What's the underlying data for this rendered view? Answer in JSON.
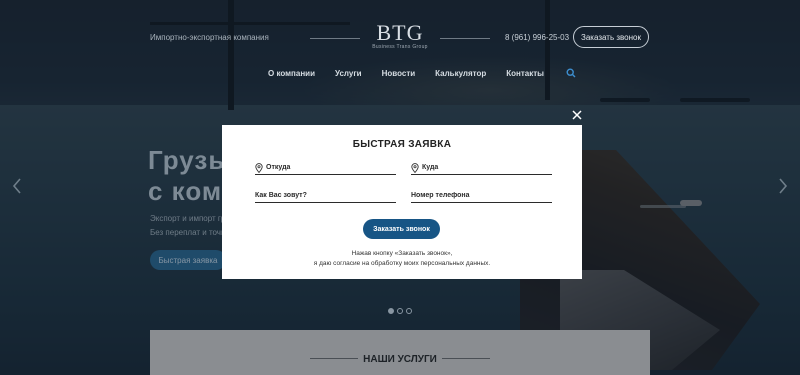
{
  "header": {
    "tagline": "Импортно-экспортная компания",
    "logo_text": "BTG",
    "logo_subtitle": "Business Trans Group",
    "phone": "8 (961) 996-25-03",
    "call_button": "Заказать звонок"
  },
  "nav": {
    "items": [
      {
        "label": "О компании"
      },
      {
        "label": "Услуги"
      },
      {
        "label": "Новости"
      },
      {
        "label": "Калькулятор"
      },
      {
        "label": "Контакты"
      }
    ],
    "search_icon": "search-icon"
  },
  "hero": {
    "title_line1": "Грузы",
    "title_line2": "с ком",
    "text_line1": "Экспорт и импорт гру",
    "text_line2": "Без переплат и точно",
    "button": "Быстрая заявка"
  },
  "slider": {
    "prev_icon": "chevron-left-icon",
    "next_icon": "chevron-right-icon",
    "active_slide": 1,
    "slide_count": 3
  },
  "services": {
    "title": "НАШИ УСЛУГИ"
  },
  "modal": {
    "title": "БЫСТРАЯ ЗАЯВКА",
    "close_icon": "close-icon",
    "fields": {
      "from": {
        "placeholder": "Откуда",
        "value": ""
      },
      "to": {
        "placeholder": "Куда",
        "value": ""
      },
      "name": {
        "placeholder": "Как Вас зовут?",
        "value": ""
      },
      "phone": {
        "placeholder": "Номер телефона",
        "value": ""
      }
    },
    "submit": "Заказать звонок",
    "consent_line1": "Нажав кнопку «Заказать звонок»,",
    "consent_line2": "я даю согласие на обработку моих персональных данных."
  },
  "colors": {
    "accent": "#175585",
    "overlay": "#0a121c"
  }
}
